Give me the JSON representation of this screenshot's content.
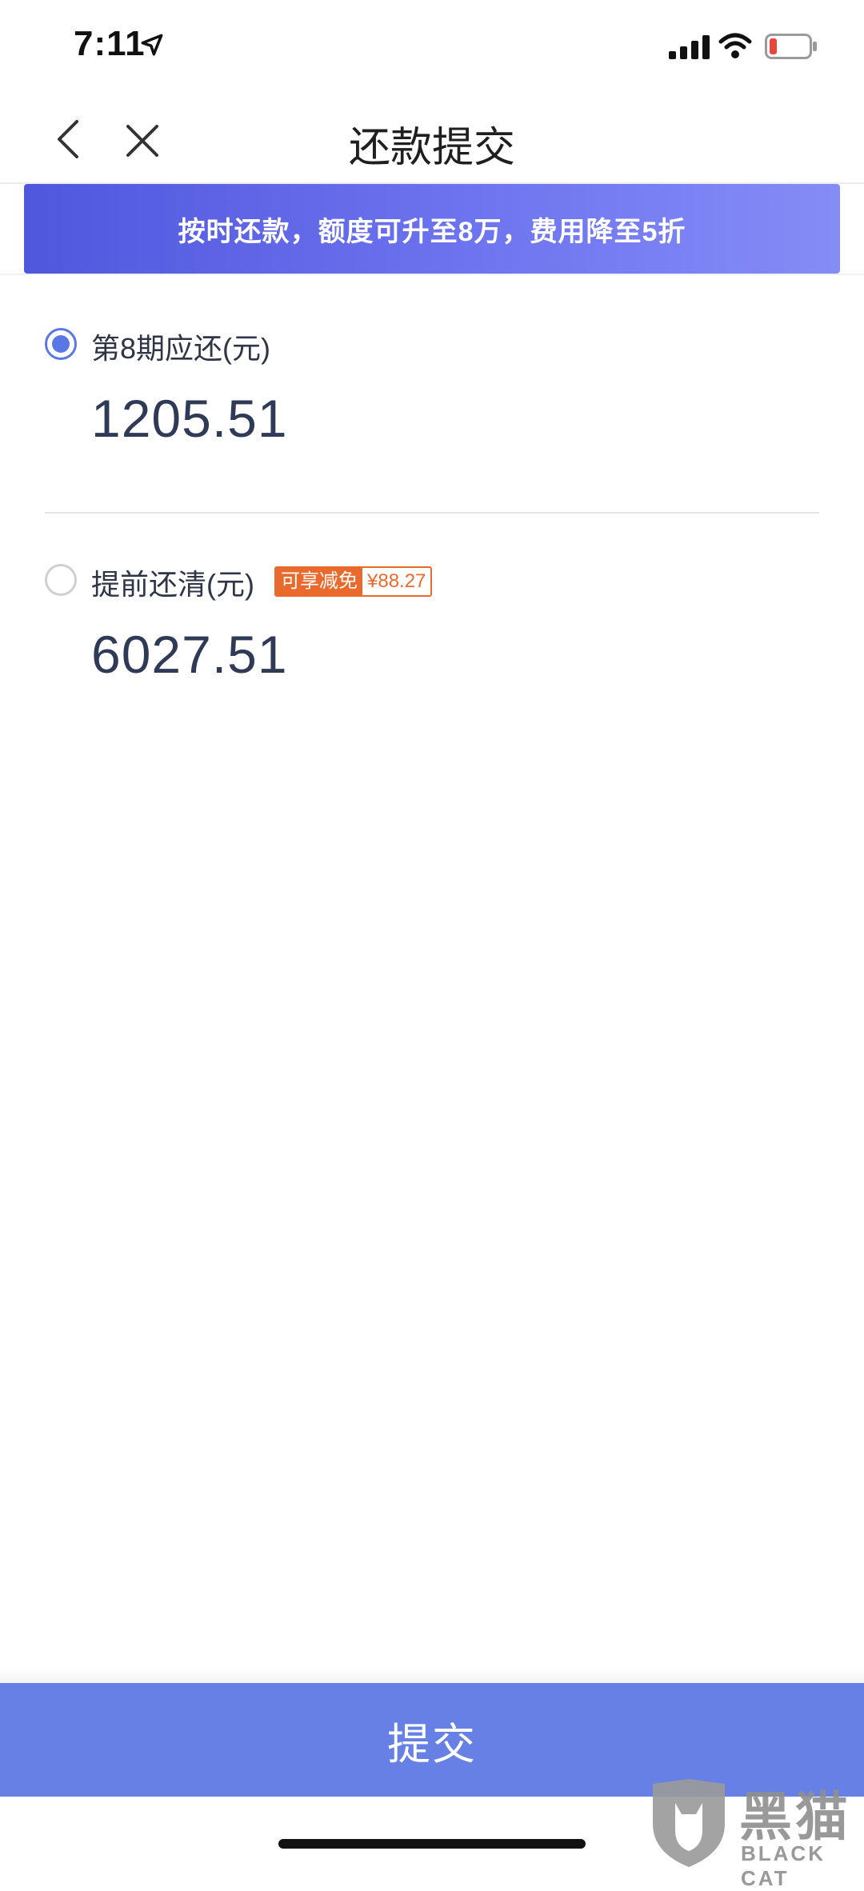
{
  "status_bar": {
    "time": "7:11",
    "icons": [
      "location-arrow-icon",
      "cellular-signal-icon",
      "wifi-icon",
      "battery-low-icon"
    ],
    "battery_color": "#e8463a"
  },
  "nav": {
    "title": "还款提交",
    "icons": [
      "chevron-left-icon",
      "close-icon"
    ]
  },
  "banner": {
    "text": "按时还款，额度可升至8万，费用降至5折"
  },
  "options": [
    {
      "label": "第8期应还(元)",
      "amount": "1205.51",
      "selected": true
    },
    {
      "label": "提前还清(元)",
      "amount": "6027.51",
      "selected": false,
      "badge": {
        "label": "可享减免",
        "value": "¥88.27"
      }
    }
  ],
  "submit": {
    "label": "提交"
  },
  "watermark": {
    "cn": "黑猫",
    "en": "BLACK CAT"
  },
  "colors": {
    "accent": "#5a77e6",
    "button": "#6780e6",
    "banner_start": "#4f58dd",
    "banner_end": "#858cf6",
    "badge": "#e96a2c"
  }
}
